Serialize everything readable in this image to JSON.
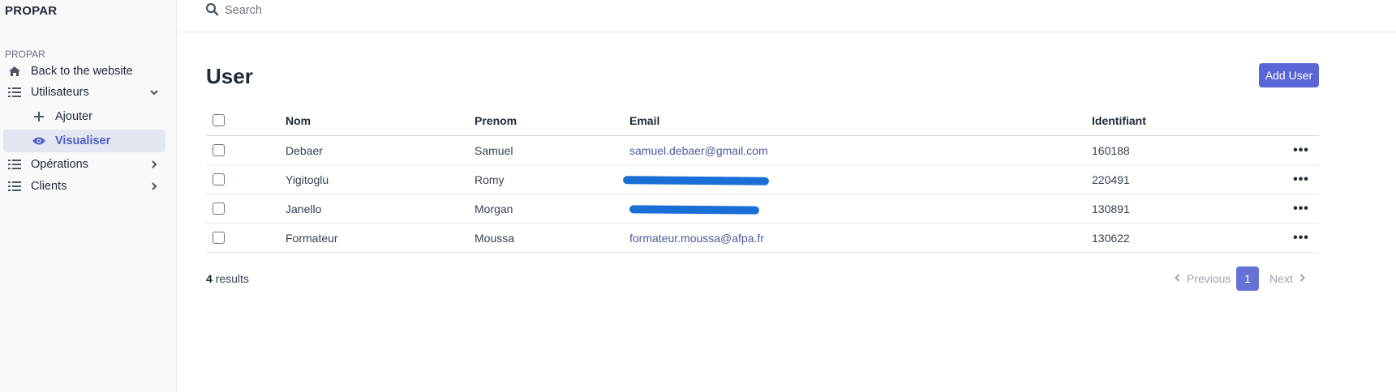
{
  "brand": "PROPAR",
  "sidebar": {
    "section_title": "PROPAR",
    "items": [
      {
        "label": "Back to the website",
        "icon": "home-icon"
      },
      {
        "label": "Utilisateurs",
        "icon": "list-icon",
        "chevron": "chevron-down-icon"
      },
      {
        "label": "Ajouter",
        "icon": "plus-icon"
      },
      {
        "label": "Visualiser",
        "icon": "eye-icon",
        "active": true
      },
      {
        "label": "Opérations",
        "icon": "list-icon",
        "chevron": "chevron-right-icon"
      },
      {
        "label": "Clients",
        "icon": "list-icon",
        "chevron": "chevron-right-icon"
      }
    ]
  },
  "search": {
    "placeholder": "Search"
  },
  "main": {
    "title": "User",
    "add_button": "Add User",
    "table": {
      "columns": [
        "Nom",
        "Prenom",
        "Email",
        "Identifiant"
      ],
      "rows": [
        {
          "nom": "Debaer",
          "prenom": "Samuel",
          "email": "samuel.debaer@gmail.com",
          "identifiant": "160188"
        },
        {
          "nom": "Yigitoglu",
          "prenom": "Romy",
          "email": "",
          "identifiant": "220491",
          "redacted": true
        },
        {
          "nom": "Janello",
          "prenom": "Morgan",
          "email": "",
          "identifiant": "130891",
          "redacted": true
        },
        {
          "nom": "Formateur",
          "prenom": "Moussa",
          "email": "formateur.moussa@afpa.fr",
          "identifiant": "130622"
        }
      ]
    },
    "results_count": "4",
    "results_label": "results",
    "pagination": {
      "previous": "Previous",
      "current": "1",
      "next": "Next"
    }
  },
  "colors": {
    "accent": "#5b66d6",
    "active_text": "#5260c9",
    "redaction": "#1a6fd6"
  }
}
